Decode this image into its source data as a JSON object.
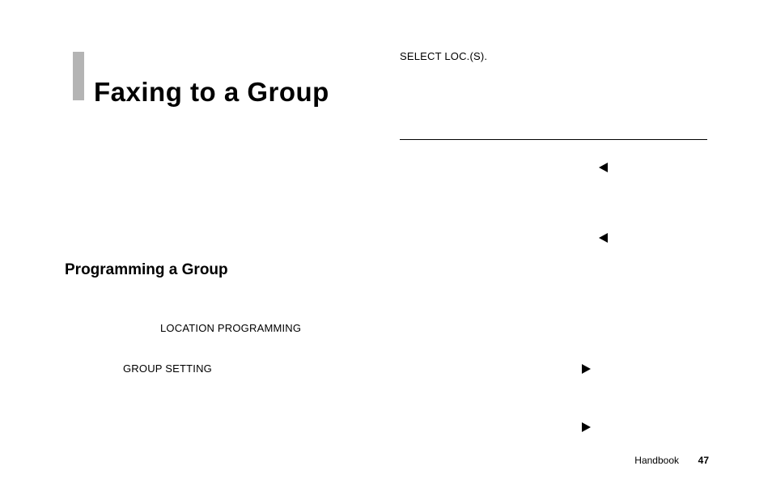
{
  "title": "Faxing to a Group",
  "subheading": "Programming a Group",
  "labels": {
    "location_programming": "LOCATION PROGRAMMING",
    "group_setting": "GROUP SETTING",
    "select_loc": "SELECT LOC.(S)."
  },
  "icons": {
    "arrow_left_1": "arrow-left",
    "arrow_left_2": "arrow-left",
    "arrow_right_1": "arrow-right",
    "arrow_right_2": "arrow-right"
  },
  "footer": {
    "label": "Handbook",
    "page": "47"
  }
}
